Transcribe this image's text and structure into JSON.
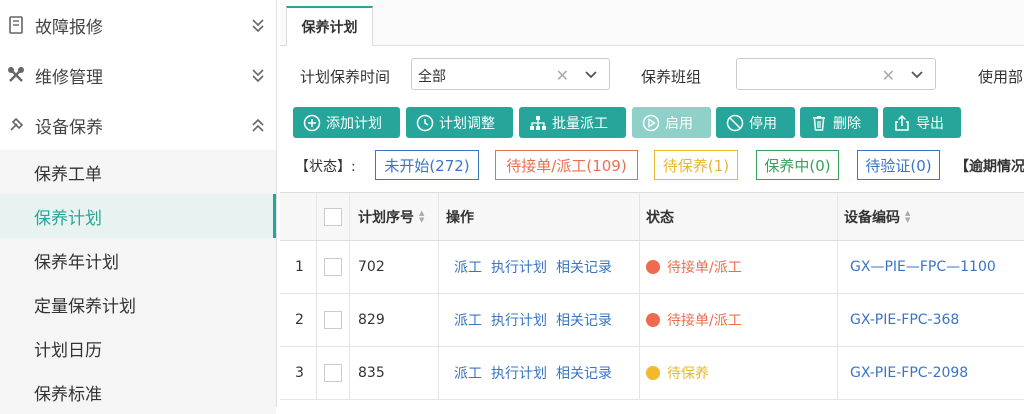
{
  "sidebar": {
    "groups": [
      {
        "label": "故障报修",
        "icon": "document-icon"
      },
      {
        "label": "维修管理",
        "icon": "tools-icon"
      },
      {
        "label": "设备保养",
        "icon": "wrench-icon"
      }
    ],
    "sub_items": [
      "保养工单",
      "保养计划",
      "保养年计划",
      "定量保养计划",
      "计划日历",
      "保养标准"
    ],
    "active": "保养计划"
  },
  "tab": {
    "label": "保养计划"
  },
  "filters": {
    "time_label": "计划保养时间",
    "time_value": "全部",
    "team_label": "保养班组",
    "team_value": "",
    "dept_label": "使用部"
  },
  "toolbar": {
    "add": "添加计划",
    "adjust": "计划调整",
    "batch": "批量派工",
    "enable": "启用",
    "disable": "停用",
    "delete": "删除",
    "export": "导出"
  },
  "status_bar": {
    "label": "【状态】:",
    "items": [
      {
        "label": "未开始(272)",
        "color": "#3a75c4"
      },
      {
        "label": "待接单/派工(109)",
        "color": "#e9704f"
      },
      {
        "label": "待保养(1)",
        "color": "#e8b732"
      },
      {
        "label": "保养中(0)",
        "color": "#3aa05a"
      },
      {
        "label": "待验证(0)",
        "color": "#3a75c4"
      }
    ],
    "overdue": "【逾期情况"
  },
  "table": {
    "headers": {
      "seq": "计划序号",
      "ops": "操作",
      "status": "状态",
      "code": "设备编码"
    },
    "action_labels": [
      "派工",
      "执行计划",
      "相关记录"
    ],
    "rows": [
      {
        "num": "1",
        "seq": "702",
        "status": "待接单/派工",
        "status_color": "#ee6b4d",
        "code": "GX—PIE—FPC—1100"
      },
      {
        "num": "2",
        "seq": "829",
        "status": "待接单/派工",
        "status_color": "#ee6b4d",
        "code": "GX-PIE-FPC-368"
      },
      {
        "num": "3",
        "seq": "835",
        "status": "待保养",
        "status_color": "#f2b82e",
        "code": "GX-PIE-FPC-2098"
      }
    ]
  }
}
